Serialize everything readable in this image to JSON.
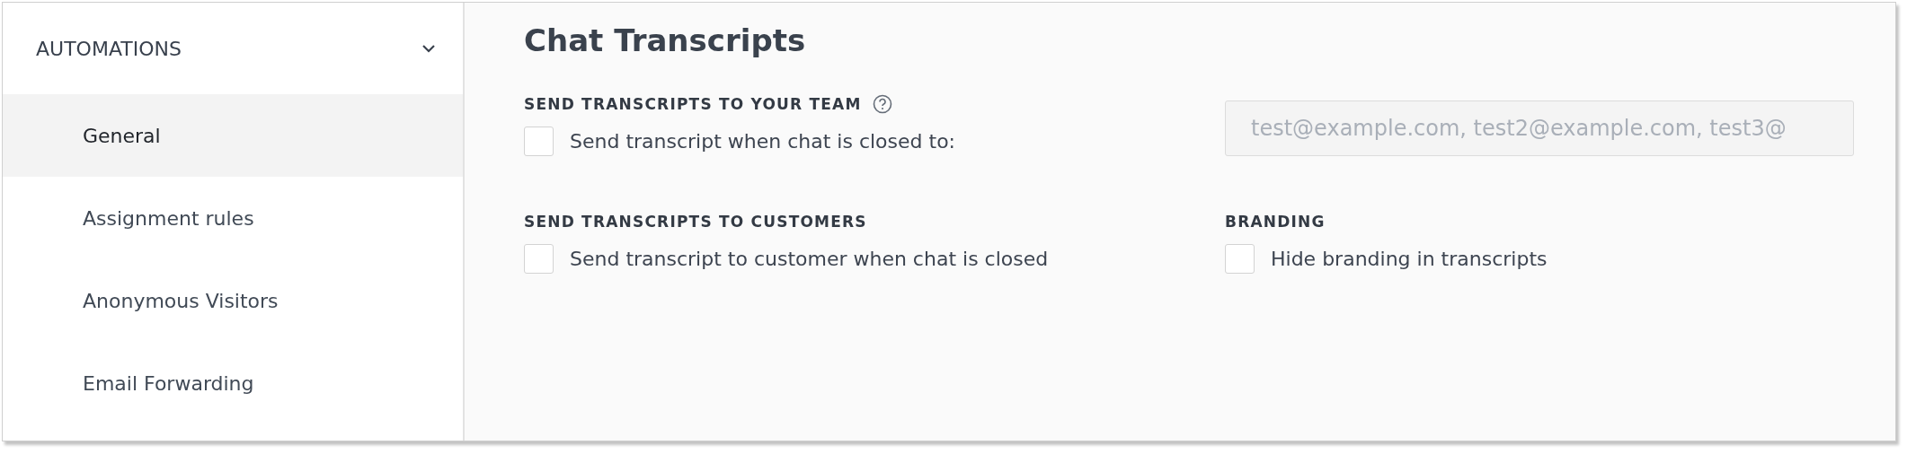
{
  "sidebar": {
    "header": {
      "label": "AUTOMATIONS",
      "expanded": true
    },
    "items": [
      {
        "label": "General",
        "selected": true
      },
      {
        "label": "Assignment rules",
        "selected": false
      },
      {
        "label": "Anonymous Visitors",
        "selected": false
      },
      {
        "label": "Email Forwarding",
        "selected": false
      }
    ]
  },
  "page_title": "Chat Transcripts",
  "team_section": {
    "heading": "SEND TRANSCRIPTS TO YOUR TEAM",
    "checkbox": {
      "label": "Send transcript when chat is closed to:",
      "checked": false
    },
    "email_field": {
      "placeholder": "test@example.com, test2@example.com, test3@"
    }
  },
  "customers_section": {
    "heading": "SEND TRANSCRIPTS TO CUSTOMERS",
    "checkbox": {
      "label": "Send transcript to customer when chat is closed",
      "checked": false
    }
  },
  "branding_section": {
    "heading": "BRANDING",
    "checkbox": {
      "label": "Hide branding in transcripts",
      "checked": false
    }
  }
}
